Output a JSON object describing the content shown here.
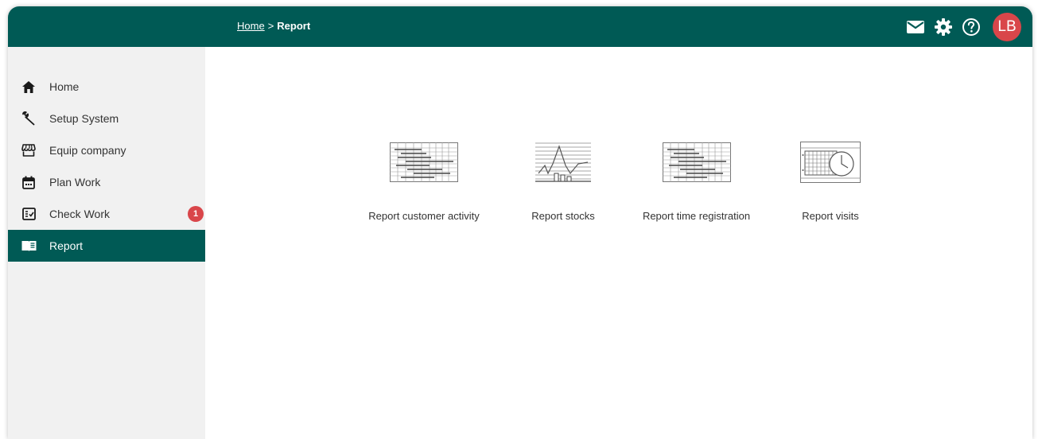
{
  "header": {
    "breadcrumb_home": "Home",
    "breadcrumb_separator": ">",
    "breadcrumb_current": "Report",
    "icons": [
      "mail-icon",
      "gear-icon",
      "help-icon"
    ],
    "avatar_initials": "LB",
    "colors": {
      "bar": "#005a55",
      "avatar": "#d9464a"
    }
  },
  "sidebar": {
    "items": [
      {
        "label": "Home",
        "icon": "home-icon"
      },
      {
        "label": "Setup System",
        "icon": "wrench-icon"
      },
      {
        "label": "Equip company",
        "icon": "store-icon"
      },
      {
        "label": "Plan Work",
        "icon": "calendar-icon"
      },
      {
        "label": "Check Work",
        "icon": "checklist-icon",
        "badge": "1"
      },
      {
        "label": "Report",
        "icon": "book-icon",
        "active": true
      }
    ]
  },
  "reports": [
    {
      "label": "Report customer activity",
      "icon": "gantt-thumbnail-icon"
    },
    {
      "label": "Report stocks",
      "icon": "line-chart-thumbnail-icon"
    },
    {
      "label": "Report time registration",
      "icon": "gantt-thumbnail-icon"
    },
    {
      "label": "Report visits",
      "icon": "calendar-clock-thumbnail-icon"
    }
  ]
}
